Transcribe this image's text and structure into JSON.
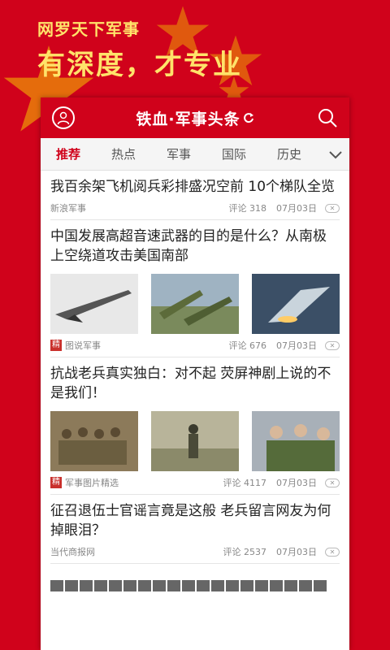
{
  "promo": {
    "line1": "网罗天下军事",
    "line2": "有深度，才专业"
  },
  "colors": {
    "brand_red": "#d0021b",
    "promo_yellow": "#ffe36a",
    "star_yellow": "#f5c400"
  },
  "header": {
    "title": "铁血·军事头条",
    "user_icon": "user-icon",
    "search_icon": "search-icon",
    "refresh_icon": "refresh-icon"
  },
  "tabs": [
    {
      "label": "推荐",
      "active": true
    },
    {
      "label": "热点",
      "active": false
    },
    {
      "label": "军事",
      "active": false
    },
    {
      "label": "国际",
      "active": false
    },
    {
      "label": "历史",
      "active": false
    }
  ],
  "tabs_more_icon": "chevron-down-icon",
  "feed": [
    {
      "title": "我百余架飞机阅兵彩排盛况空前 10个梯队全览",
      "source": "新浪军事",
      "comments": "评论 318",
      "date": "07月03日",
      "close": "✕"
    },
    {
      "title": "中国发展高超音速武器的目的是什么？从南极上空绕道攻击美国南部",
      "source_tag": "精",
      "source": "图说军事",
      "comments": "评论 676",
      "date": "07月03日",
      "close": "✕"
    },
    {
      "title": "抗战老兵真实独白：对不起 荧屏神剧上说的不是我们！",
      "source_tag": "精",
      "source": "军事图片精选",
      "comments": "评论 4117",
      "date": "07月03日",
      "close": "✕"
    },
    {
      "title": "征召退伍士官谣言竟是这般 老兵留言网友为何掉眼泪？",
      "source": "当代商报网",
      "comments": "评论 2537",
      "date": "07月03日",
      "close": "✕"
    }
  ]
}
